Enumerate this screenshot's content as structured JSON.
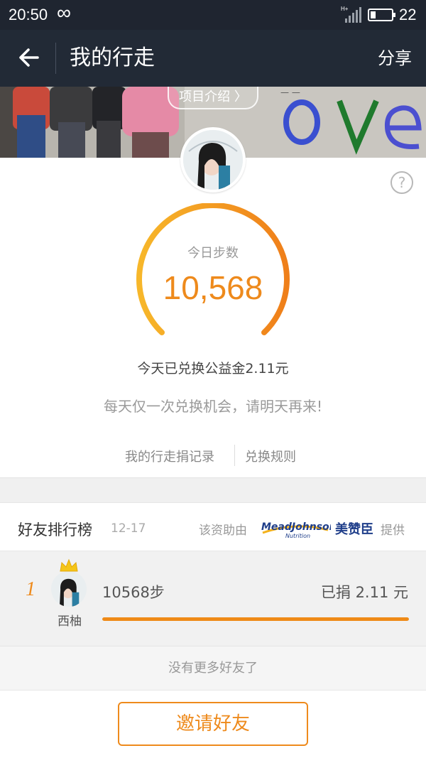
{
  "status_bar": {
    "time": "20:50",
    "network_type": "H+",
    "battery_level": "22",
    "battery_fraction": 0.22
  },
  "nav": {
    "title": "我的行走",
    "share_label": "分享",
    "back_icon": "arrow-left-icon"
  },
  "banner": {
    "project_intro_label": "项目介绍 〉"
  },
  "gauge": {
    "label": "今日步数",
    "value": "10,568",
    "color": "#ee8a1c"
  },
  "summary": {
    "exchanged_text": "今天已兑换公益金2.11元",
    "daily_note": "每天仅一次兑换机会，请明天再来!"
  },
  "links": {
    "record": "我的行走捐记录",
    "rules": "兑换规则"
  },
  "ranking": {
    "title": "好友排行榜",
    "date": "12-17",
    "sponsor_prefix": "该资助由",
    "sponsor_logo_text": "MeadJohnson",
    "sponsor_logo_sub": "Nutrition",
    "sponsor_cn": "美赞臣",
    "sponsor_suffix": "提供",
    "friends": [
      {
        "rank": "1",
        "name": "西柚",
        "steps": "10568步",
        "donated": "已捐 2.11 元",
        "progress": 1.0
      }
    ],
    "no_more": "没有更多好友了"
  },
  "invite_label": "邀请好友",
  "colors": {
    "accent": "#ee8a1c",
    "nav_bg": "#222a36",
    "status_bg": "#1f2530"
  }
}
